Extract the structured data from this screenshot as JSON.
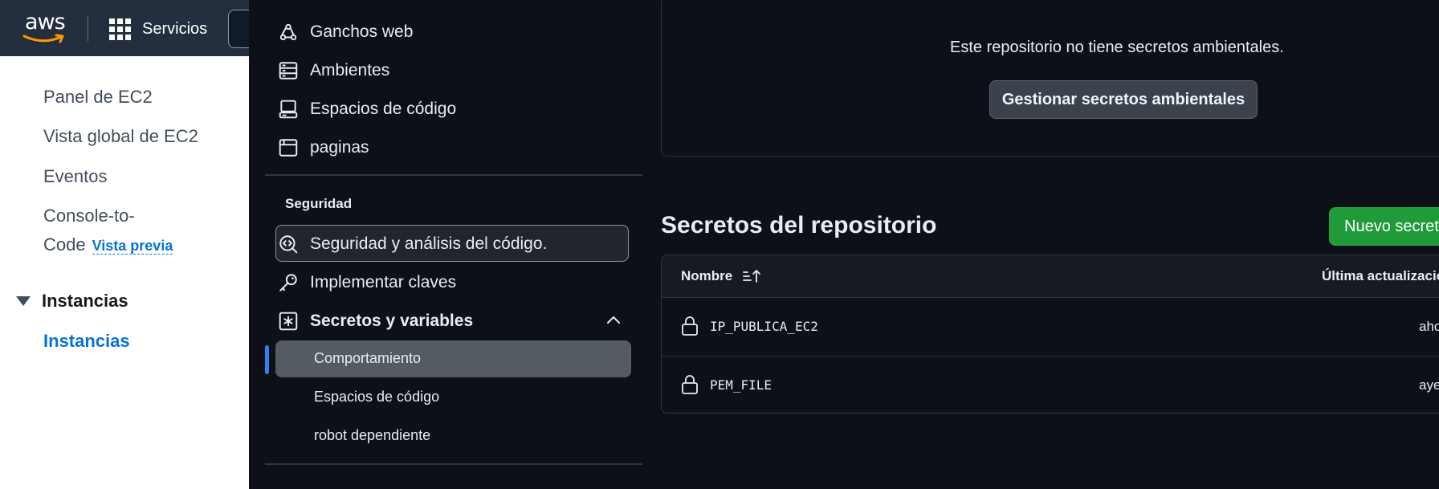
{
  "aws": {
    "logo_text": "aws",
    "services_label": "Servicios",
    "sidebar": {
      "items": [
        "Panel de EC2",
        "Vista global de EC2",
        "Eventos"
      ],
      "console_to_code_line1": "Console-to-",
      "console_to_code_line2": "Code",
      "preview_badge": "Vista previa",
      "instances_section": "Instancias",
      "instances_link": "Instancias"
    }
  },
  "github": {
    "nav": {
      "items": [
        {
          "label": "Ganchos web",
          "icon": "webhook-icon"
        },
        {
          "label": "Ambientes",
          "icon": "server-icon"
        },
        {
          "label": "Espacios de código",
          "icon": "codespaces-icon"
        },
        {
          "label": "paginas",
          "icon": "browser-icon"
        }
      ],
      "security_heading": "Seguridad",
      "security_items": [
        {
          "label": "Seguridad y análisis del código.",
          "icon": "codescan-icon"
        },
        {
          "label": "Implementar claves",
          "icon": "key-icon"
        },
        {
          "label": "Secretos y variables",
          "icon": "asterisk-icon"
        }
      ],
      "sub_items": [
        "Comportamiento",
        "Espacios de código",
        "robot dependiente"
      ]
    },
    "environment": {
      "message": "Este repositorio no tiene secretos ambientales.",
      "manage_button": "Gestionar secretos ambientales"
    },
    "repo_secrets": {
      "title": "Secretos del repositorio",
      "new_button": "Nuevo secreto del repositorio",
      "columns": {
        "name": "Nombre",
        "updated": "Última actualización"
      },
      "rows": [
        {
          "name": "IP_PUBLICA_EC2",
          "updated": "ahora"
        },
        {
          "name": "PEM_FILE",
          "updated": "ayer"
        }
      ]
    },
    "colors": {
      "bg": "#0d1117",
      "accent": "#2f81f7",
      "green": "#1f9b3a"
    }
  }
}
